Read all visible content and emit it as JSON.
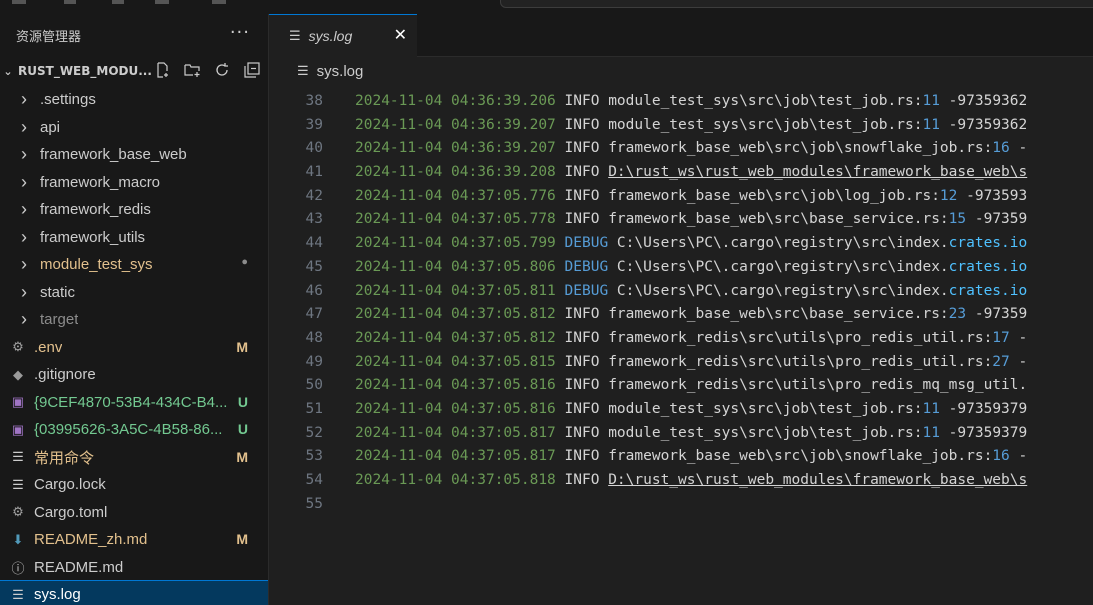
{
  "explorer": {
    "title": "资源管理器",
    "more": "···",
    "project_name": "RUST_WEB_MODU...",
    "items": [
      {
        "kind": "folder",
        "label": ".settings",
        "color": "#cccccc",
        "badge": ""
      },
      {
        "kind": "folder",
        "label": "api",
        "color": "#cccccc",
        "badge": ""
      },
      {
        "kind": "folder",
        "label": "framework_base_web",
        "color": "#cccccc",
        "badge": ""
      },
      {
        "kind": "folder",
        "label": "framework_macro",
        "color": "#cccccc",
        "badge": ""
      },
      {
        "kind": "folder",
        "label": "framework_redis",
        "color": "#cccccc",
        "badge": ""
      },
      {
        "kind": "folder",
        "label": "framework_utils",
        "color": "#cccccc",
        "badge": ""
      },
      {
        "kind": "folder",
        "label": "module_test_sys",
        "color": "#e2c08d",
        "badge": "●"
      },
      {
        "kind": "folder",
        "label": "static",
        "color": "#cccccc",
        "badge": ""
      },
      {
        "kind": "folder",
        "label": "target",
        "color": "#8c8c8c",
        "badge": ""
      },
      {
        "kind": "file",
        "icon": "gear-icon",
        "label": ".env",
        "color": "#e2c08d",
        "badge": "M"
      },
      {
        "kind": "file",
        "icon": "git-icon",
        "label": ".gitignore",
        "color": "#cccccc",
        "badge": ""
      },
      {
        "kind": "file",
        "icon": "image-icon",
        "label": "{9CEF4870-53B4-434C-B4...",
        "color": "#73c991",
        "badge": "U"
      },
      {
        "kind": "file",
        "icon": "image-icon",
        "label": "{03995626-3A5C-4B58-86...",
        "color": "#73c991",
        "badge": "U"
      },
      {
        "kind": "file",
        "icon": "lines-icon",
        "label": "常用命令",
        "color": "#e2c08d",
        "badge": "M"
      },
      {
        "kind": "file",
        "icon": "lines-icon",
        "label": "Cargo.lock",
        "color": "#cccccc",
        "badge": ""
      },
      {
        "kind": "file",
        "icon": "gear-icon",
        "label": "Cargo.toml",
        "color": "#cccccc",
        "badge": ""
      },
      {
        "kind": "file",
        "icon": "download-icon",
        "label": "README_zh.md",
        "color": "#e2c08d",
        "badge": "M"
      },
      {
        "kind": "file",
        "icon": "info-icon",
        "label": "README.md",
        "color": "#cccccc",
        "badge": ""
      },
      {
        "kind": "file",
        "icon": "lines-icon",
        "label": "sys.log",
        "color": "#ffffff",
        "badge": "",
        "selected": true
      }
    ]
  },
  "tab": {
    "label": "sys.log",
    "close": "✕"
  },
  "breadcrumb": {
    "label": "sys.log"
  },
  "lines": [
    {
      "n": "38",
      "ts": "2024-11-04 04:36:39.206",
      "lvl": "INFO",
      "path": "module_test_sys\\src\\job\\test_job.rs:",
      "num": "11",
      "rest": " -97359362",
      "ul": false
    },
    {
      "n": "39",
      "ts": "2024-11-04 04:36:39.207",
      "lvl": "INFO",
      "path": "module_test_sys\\src\\job\\test_job.rs:",
      "num": "11",
      "rest": " -97359362",
      "ul": false
    },
    {
      "n": "40",
      "ts": "2024-11-04 04:36:39.207",
      "lvl": "INFO",
      "path": "framework_base_web\\src\\job\\snowflake_job.rs:",
      "num": "16",
      "rest": " -",
      "ul": false
    },
    {
      "n": "41",
      "ts": "2024-11-04 04:36:39.208",
      "lvl": "INFO",
      "path": "D:\\rust_ws\\rust_web_modules\\framework_base_web\\s",
      "num": "",
      "rest": "",
      "ul": true
    },
    {
      "n": "42",
      "ts": "2024-11-04 04:37:05.776",
      "lvl": "INFO",
      "path": "framework_base_web\\src\\job\\log_job.rs:",
      "num": "12",
      "rest": " -973593",
      "ul": false
    },
    {
      "n": "43",
      "ts": "2024-11-04 04:37:05.778",
      "lvl": "INFO",
      "path": "framework_base_web\\src\\base_service.rs:",
      "num": "15",
      "rest": " -97359",
      "ul": false
    },
    {
      "n": "44",
      "ts": "2024-11-04 04:37:05.799",
      "lvl": "DEBUG",
      "path": "C:\\Users\\PC\\.cargo\\registry\\src\\index.",
      "num": "",
      "rest": "",
      "hl": "crates.io",
      "ul": false
    },
    {
      "n": "45",
      "ts": "2024-11-04 04:37:05.806",
      "lvl": "DEBUG",
      "path": "C:\\Users\\PC\\.cargo\\registry\\src\\index.",
      "num": "",
      "rest": "",
      "hl": "crates.io",
      "ul": false
    },
    {
      "n": "46",
      "ts": "2024-11-04 04:37:05.811",
      "lvl": "DEBUG",
      "path": "C:\\Users\\PC\\.cargo\\registry\\src\\index.",
      "num": "",
      "rest": "",
      "hl": "crates.io",
      "ul": false
    },
    {
      "n": "47",
      "ts": "2024-11-04 04:37:05.812",
      "lvl": "INFO",
      "path": "framework_base_web\\src\\base_service.rs:",
      "num": "23",
      "rest": " -97359",
      "ul": false
    },
    {
      "n": "48",
      "ts": "2024-11-04 04:37:05.812",
      "lvl": "INFO",
      "path": "framework_redis\\src\\utils\\pro_redis_util.rs:",
      "num": "17",
      "rest": " -",
      "ul": false
    },
    {
      "n": "49",
      "ts": "2024-11-04 04:37:05.815",
      "lvl": "INFO",
      "path": "framework_redis\\src\\utils\\pro_redis_util.rs:",
      "num": "27",
      "rest": " -",
      "ul": false
    },
    {
      "n": "50",
      "ts": "2024-11-04 04:37:05.816",
      "lvl": "INFO",
      "path": "framework_redis\\src\\utils\\pro_redis_mq_msg_util.",
      "num": "",
      "rest": "",
      "ul": false
    },
    {
      "n": "51",
      "ts": "2024-11-04 04:37:05.816",
      "lvl": "INFO",
      "path": "module_test_sys\\src\\job\\test_job.rs:",
      "num": "11",
      "rest": " -97359379",
      "ul": false
    },
    {
      "n": "52",
      "ts": "2024-11-04 04:37:05.817",
      "lvl": "INFO",
      "path": "module_test_sys\\src\\job\\test_job.rs:",
      "num": "11",
      "rest": " -97359379",
      "ul": false
    },
    {
      "n": "53",
      "ts": "2024-11-04 04:37:05.817",
      "lvl": "INFO",
      "path": "framework_base_web\\src\\job\\snowflake_job.rs:",
      "num": "16",
      "rest": " -",
      "ul": false
    },
    {
      "n": "54",
      "ts": "2024-11-04 04:37:05.818",
      "lvl": "INFO",
      "path": "D:\\rust_ws\\rust_web_modules\\framework_base_web\\s",
      "num": "",
      "rest": "",
      "ul": true
    },
    {
      "n": "55",
      "ts": "",
      "lvl": "",
      "path": "",
      "num": "",
      "rest": "",
      "ul": false
    }
  ]
}
